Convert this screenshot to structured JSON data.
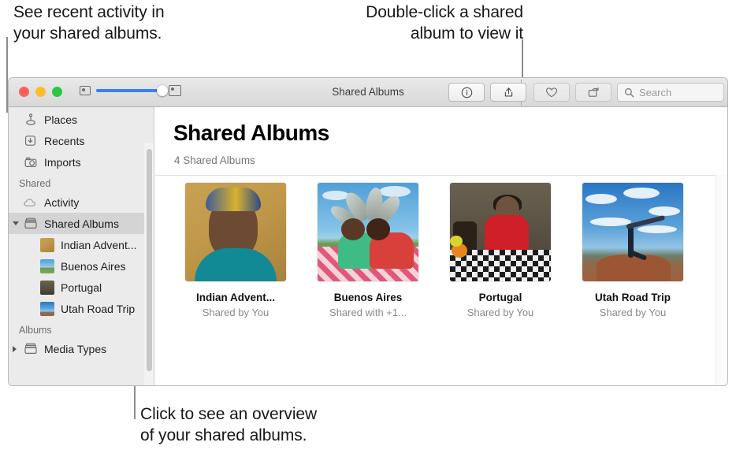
{
  "callouts": {
    "activity": "See recent activity in\nyour shared albums.",
    "double_click": "Double-click a shared\nalbum to view it",
    "overview": "Click to see an overview\nof your shared albums."
  },
  "window": {
    "title": "Shared Albums",
    "traffic_lights": [
      "close",
      "minimize",
      "zoom"
    ],
    "zoom_slider": {
      "min_icon": "small-thumbnail-icon",
      "max_icon": "large-thumbnail-icon",
      "value": 100
    },
    "toolbar": {
      "info_label": "ⓘ",
      "buttons": [
        {
          "name": "info-button",
          "icon": "info-circle-icon"
        },
        {
          "name": "share-button",
          "icon": "share-icon"
        },
        {
          "name": "favorite-button",
          "icon": "heart-icon"
        },
        {
          "name": "rotate-button",
          "icon": "rotate-icon"
        }
      ]
    },
    "search": {
      "placeholder": "Search",
      "value": "",
      "icon": "search-icon"
    }
  },
  "sidebar": {
    "items": [
      {
        "label": "Places",
        "icon": "pin-icon",
        "selected": false
      },
      {
        "label": "Recents",
        "icon": "recents-icon",
        "selected": false
      },
      {
        "label": "Imports",
        "icon": "camera-icon",
        "selected": false
      }
    ],
    "shared_header": "Shared",
    "shared_items": [
      {
        "label": "Activity",
        "icon": "cloud-icon",
        "selected": false
      },
      {
        "label": "Shared Albums",
        "icon": "album-icon",
        "selected": true
      }
    ],
    "album_children": [
      {
        "label": "Indian Advent...",
        "thumb": "indian"
      },
      {
        "label": "Buenos Aires",
        "thumb": "buenos"
      },
      {
        "label": "Portugal",
        "thumb": "portugal"
      },
      {
        "label": "Utah Road Trip",
        "thumb": "utah"
      }
    ],
    "albums_header": "Albums",
    "albums_items": [
      {
        "label": "Media Types",
        "icon": "album-icon",
        "collapsed": true
      }
    ]
  },
  "main": {
    "title": "Shared Albums",
    "subtitle": "4 Shared Albums",
    "albums": [
      {
        "name": "Indian Advent...",
        "sharing": "Shared by You",
        "thumb": "indian"
      },
      {
        "name": "Buenos Aires",
        "sharing": "Shared with +1...",
        "thumb": "buenos"
      },
      {
        "name": "Portugal",
        "sharing": "Shared by You",
        "thumb": "portugal"
      },
      {
        "name": "Utah Road Trip",
        "sharing": "Shared by You",
        "thumb": "utah"
      }
    ]
  },
  "colors": {
    "accent": "#3b7ff5",
    "sidebar_bg": "#ebebeb",
    "selection": "#d4d4d4",
    "titlebar_top": "#e9e9e9",
    "callout_text": "#16181a",
    "leader_line": "#8c8c8c"
  }
}
